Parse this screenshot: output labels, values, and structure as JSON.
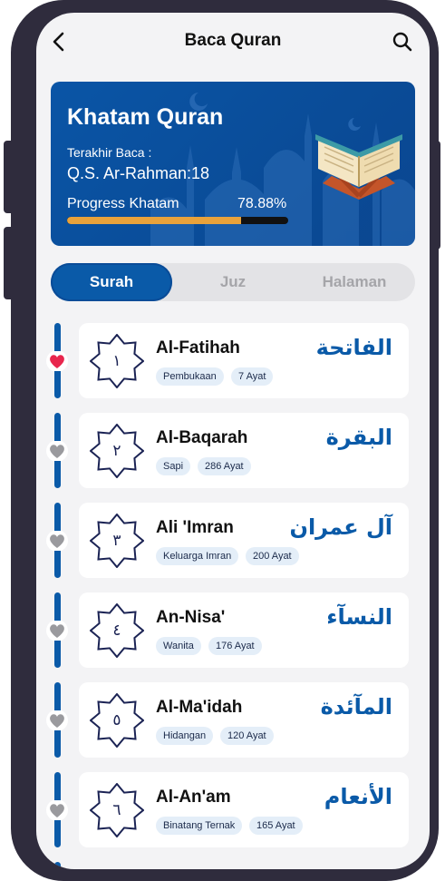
{
  "header": {
    "title": "Baca Quran",
    "back_icon": "chevron-left-icon",
    "search_icon": "search-icon"
  },
  "banner": {
    "title": "Khatam Quran",
    "last_read_label": "Terakhir Baca :",
    "last_read_surah": "Q.S. Ar-Rahman:18",
    "progress_label": "Progress Khatam",
    "progress_text": "78.88%",
    "progress_value": 0.7888,
    "colors": {
      "background": "#0a55a6",
      "progress": "#e9a23b",
      "track": "#111111"
    }
  },
  "tabs": [
    {
      "label": "Surah",
      "active": true
    },
    {
      "label": "Juz",
      "active": false
    },
    {
      "label": "Halaman",
      "active": false
    }
  ],
  "surahs": [
    {
      "number": "١",
      "name": "Al-Fatihah",
      "arabic": "الفاتحة",
      "meaning": "Pembukaan",
      "ayat": "7 Ayat",
      "favorite": true
    },
    {
      "number": "٢",
      "name": "Al-Baqarah",
      "arabic": "البقرة",
      "meaning": "Sapi",
      "ayat": "286 Ayat",
      "favorite": false
    },
    {
      "number": "٣",
      "name": "Ali 'Imran",
      "arabic": "آل عمران",
      "meaning": "Keluarga Imran",
      "ayat": "200 Ayat",
      "favorite": false
    },
    {
      "number": "٤",
      "name": "An-Nisa'",
      "arabic": "النسآء",
      "meaning": "Wanita",
      "ayat": "176 Ayat",
      "favorite": false
    },
    {
      "number": "٥",
      "name": "Al-Ma'idah",
      "arabic": "المآئدة",
      "meaning": "Hidangan",
      "ayat": "120 Ayat",
      "favorite": false
    },
    {
      "number": "٦",
      "name": "Al-An'am",
      "arabic": "الأنعام",
      "meaning": "Binatang Ternak",
      "ayat": "165 Ayat",
      "favorite": false
    }
  ],
  "colors": {
    "accent": "#0a5aa8",
    "favorite": "#e8264d",
    "unfavorite": "#9a9a9e"
  }
}
